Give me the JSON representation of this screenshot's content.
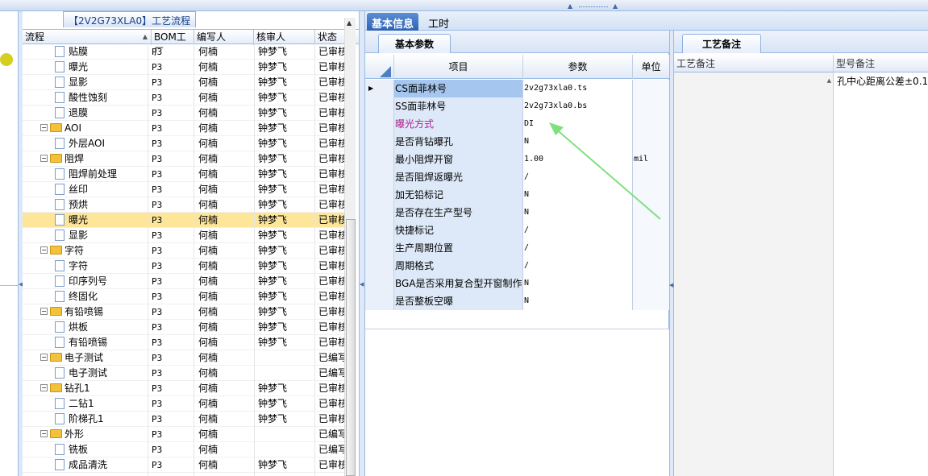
{
  "tree_panel": {
    "title": "【2V2G73XLA0】工艺流程",
    "columns": [
      "流程",
      "BOM工厂",
      "编写人",
      "核审人",
      "状态"
    ],
    "rows": [
      {
        "level": 2,
        "icon": "doc",
        "name": "贴膜",
        "bom": "P3",
        "writer": "何楠",
        "reviewer": "钟梦飞",
        "status": "已审核",
        "selected": false
      },
      {
        "level": 2,
        "icon": "doc",
        "name": "曝光",
        "bom": "P3",
        "writer": "何楠",
        "reviewer": "钟梦飞",
        "status": "已审核",
        "selected": false
      },
      {
        "level": 2,
        "icon": "doc",
        "name": "显影",
        "bom": "P3",
        "writer": "何楠",
        "reviewer": "钟梦飞",
        "status": "已审核",
        "selected": false
      },
      {
        "level": 2,
        "icon": "doc",
        "name": "酸性蚀刻",
        "bom": "P3",
        "writer": "何楠",
        "reviewer": "钟梦飞",
        "status": "已审核",
        "selected": false
      },
      {
        "level": 2,
        "icon": "doc",
        "name": "退膜",
        "bom": "P3",
        "writer": "何楠",
        "reviewer": "钟梦飞",
        "status": "已审核",
        "selected": false
      },
      {
        "level": 1,
        "icon": "folder",
        "name": "AOI",
        "bom": "P3",
        "writer": "何楠",
        "reviewer": "钟梦飞",
        "status": "已审核",
        "selected": false
      },
      {
        "level": 2,
        "icon": "doc",
        "name": "外层AOI",
        "bom": "P3",
        "writer": "何楠",
        "reviewer": "钟梦飞",
        "status": "已审核",
        "selected": false
      },
      {
        "level": 1,
        "icon": "folder",
        "name": "阻焊",
        "bom": "P3",
        "writer": "何楠",
        "reviewer": "钟梦飞",
        "status": "已审核",
        "selected": false
      },
      {
        "level": 2,
        "icon": "doc",
        "name": "阻焊前处理",
        "bom": "P3",
        "writer": "何楠",
        "reviewer": "钟梦飞",
        "status": "已审核",
        "selected": false
      },
      {
        "level": 2,
        "icon": "doc",
        "name": "丝印",
        "bom": "P3",
        "writer": "何楠",
        "reviewer": "钟梦飞",
        "status": "已审核",
        "selected": false
      },
      {
        "level": 2,
        "icon": "doc",
        "name": "预烘",
        "bom": "P3",
        "writer": "何楠",
        "reviewer": "钟梦飞",
        "status": "已审核",
        "selected": false
      },
      {
        "level": 2,
        "icon": "doc",
        "name": "曝光",
        "bom": "P3",
        "writer": "何楠",
        "reviewer": "钟梦飞",
        "status": "已审核",
        "selected": true
      },
      {
        "level": 2,
        "icon": "doc",
        "name": "显影",
        "bom": "P3",
        "writer": "何楠",
        "reviewer": "钟梦飞",
        "status": "已审核",
        "selected": false
      },
      {
        "level": 1,
        "icon": "folder",
        "name": "字符",
        "bom": "P3",
        "writer": "何楠",
        "reviewer": "钟梦飞",
        "status": "已审核",
        "selected": false
      },
      {
        "level": 2,
        "icon": "doc",
        "name": "字符",
        "bom": "P3",
        "writer": "何楠",
        "reviewer": "钟梦飞",
        "status": "已审核",
        "selected": false
      },
      {
        "level": 2,
        "icon": "doc",
        "name": "印序列号",
        "bom": "P3",
        "writer": "何楠",
        "reviewer": "钟梦飞",
        "status": "已审核",
        "selected": false
      },
      {
        "level": 2,
        "icon": "doc",
        "name": "终固化",
        "bom": "P3",
        "writer": "何楠",
        "reviewer": "钟梦飞",
        "status": "已审核",
        "selected": false
      },
      {
        "level": 1,
        "icon": "folder",
        "name": "有铅喷锡",
        "bom": "P3",
        "writer": "何楠",
        "reviewer": "钟梦飞",
        "status": "已审核",
        "selected": false
      },
      {
        "level": 2,
        "icon": "doc",
        "name": "烘板",
        "bom": "P3",
        "writer": "何楠",
        "reviewer": "钟梦飞",
        "status": "已审核",
        "selected": false
      },
      {
        "level": 2,
        "icon": "doc",
        "name": "有铅喷锡",
        "bom": "P3",
        "writer": "何楠",
        "reviewer": "钟梦飞",
        "status": "已审核",
        "selected": false
      },
      {
        "level": 1,
        "icon": "folder",
        "name": "电子测试",
        "bom": "P3",
        "writer": "何楠",
        "reviewer": "",
        "status": "已编写",
        "selected": false
      },
      {
        "level": 2,
        "icon": "doc",
        "name": "电子测试",
        "bom": "P3",
        "writer": "何楠",
        "reviewer": "",
        "status": "已编写",
        "selected": false
      },
      {
        "level": 1,
        "icon": "folder",
        "name": "钻孔1",
        "bom": "P3",
        "writer": "何楠",
        "reviewer": "钟梦飞",
        "status": "已审核",
        "selected": false
      },
      {
        "level": 2,
        "icon": "doc",
        "name": "二钻1",
        "bom": "P3",
        "writer": "何楠",
        "reviewer": "钟梦飞",
        "status": "已审核",
        "selected": false
      },
      {
        "level": 2,
        "icon": "doc",
        "name": "阶梯孔1",
        "bom": "P3",
        "writer": "何楠",
        "reviewer": "钟梦飞",
        "status": "已审核",
        "selected": false
      },
      {
        "level": 1,
        "icon": "folder",
        "name": "外形",
        "bom": "P3",
        "writer": "何楠",
        "reviewer": "",
        "status": "已编写",
        "selected": false
      },
      {
        "level": 2,
        "icon": "doc",
        "name": "铣板",
        "bom": "P3",
        "writer": "何楠",
        "reviewer": "",
        "status": "已编写",
        "selected": false
      },
      {
        "level": 2,
        "icon": "doc",
        "name": "成品清洗",
        "bom": "P3",
        "writer": "何楠",
        "reviewer": "钟梦飞",
        "status": "已审核",
        "selected": false
      }
    ]
  },
  "main_tabs": [
    {
      "label": "基本信息",
      "active": true
    },
    {
      "label": "工时",
      "active": false
    }
  ],
  "params_panel": {
    "tab_label": "基本参数",
    "columns": [
      "项目",
      "参数",
      "单位"
    ],
    "rows": [
      {
        "key": "CS面菲林号",
        "value": "2v2g73xla0.ts",
        "unit": "",
        "style": "cur"
      },
      {
        "key": "SS面菲林号",
        "value": "2v2g73xla0.bs",
        "unit": "",
        "style": ""
      },
      {
        "key": "曝光方式",
        "value": "DI",
        "unit": "",
        "style": "mag"
      },
      {
        "key": "是否背钻曝孔",
        "value": "N",
        "unit": "",
        "style": ""
      },
      {
        "key": "最小阻焊开窗",
        "value": "1.00",
        "unit": "mil",
        "style": ""
      },
      {
        "key": "是否阻焊返曝光",
        "value": "/",
        "unit": "",
        "style": ""
      },
      {
        "key": "加无铅标记",
        "value": "N",
        "unit": "",
        "style": ""
      },
      {
        "key": "是否存在生产型号",
        "value": "N",
        "unit": "",
        "style": ""
      },
      {
        "key": "快捷标记",
        "value": "/",
        "unit": "",
        "style": ""
      },
      {
        "key": "生产周期位置",
        "value": "/",
        "unit": "",
        "style": ""
      },
      {
        "key": "周期格式",
        "value": "/",
        "unit": "",
        "style": ""
      },
      {
        "key": "BGA是否采用复合型开窗制作",
        "value": "N",
        "unit": "",
        "style": ""
      },
      {
        "key": "是否整板空曝",
        "value": "N",
        "unit": "",
        "style": ""
      }
    ]
  },
  "notes_panel": {
    "tab_label": "工艺备注",
    "columns": [
      "工艺备注",
      "型号备注"
    ],
    "model_note": "孔中心距离公差±0.1"
  },
  "colors": {
    "selected_row": "#fde59a",
    "accent_tab": "#2c62b4",
    "annotation_arrow": "#7fe07f",
    "highlight_key": "#b01c8d"
  }
}
